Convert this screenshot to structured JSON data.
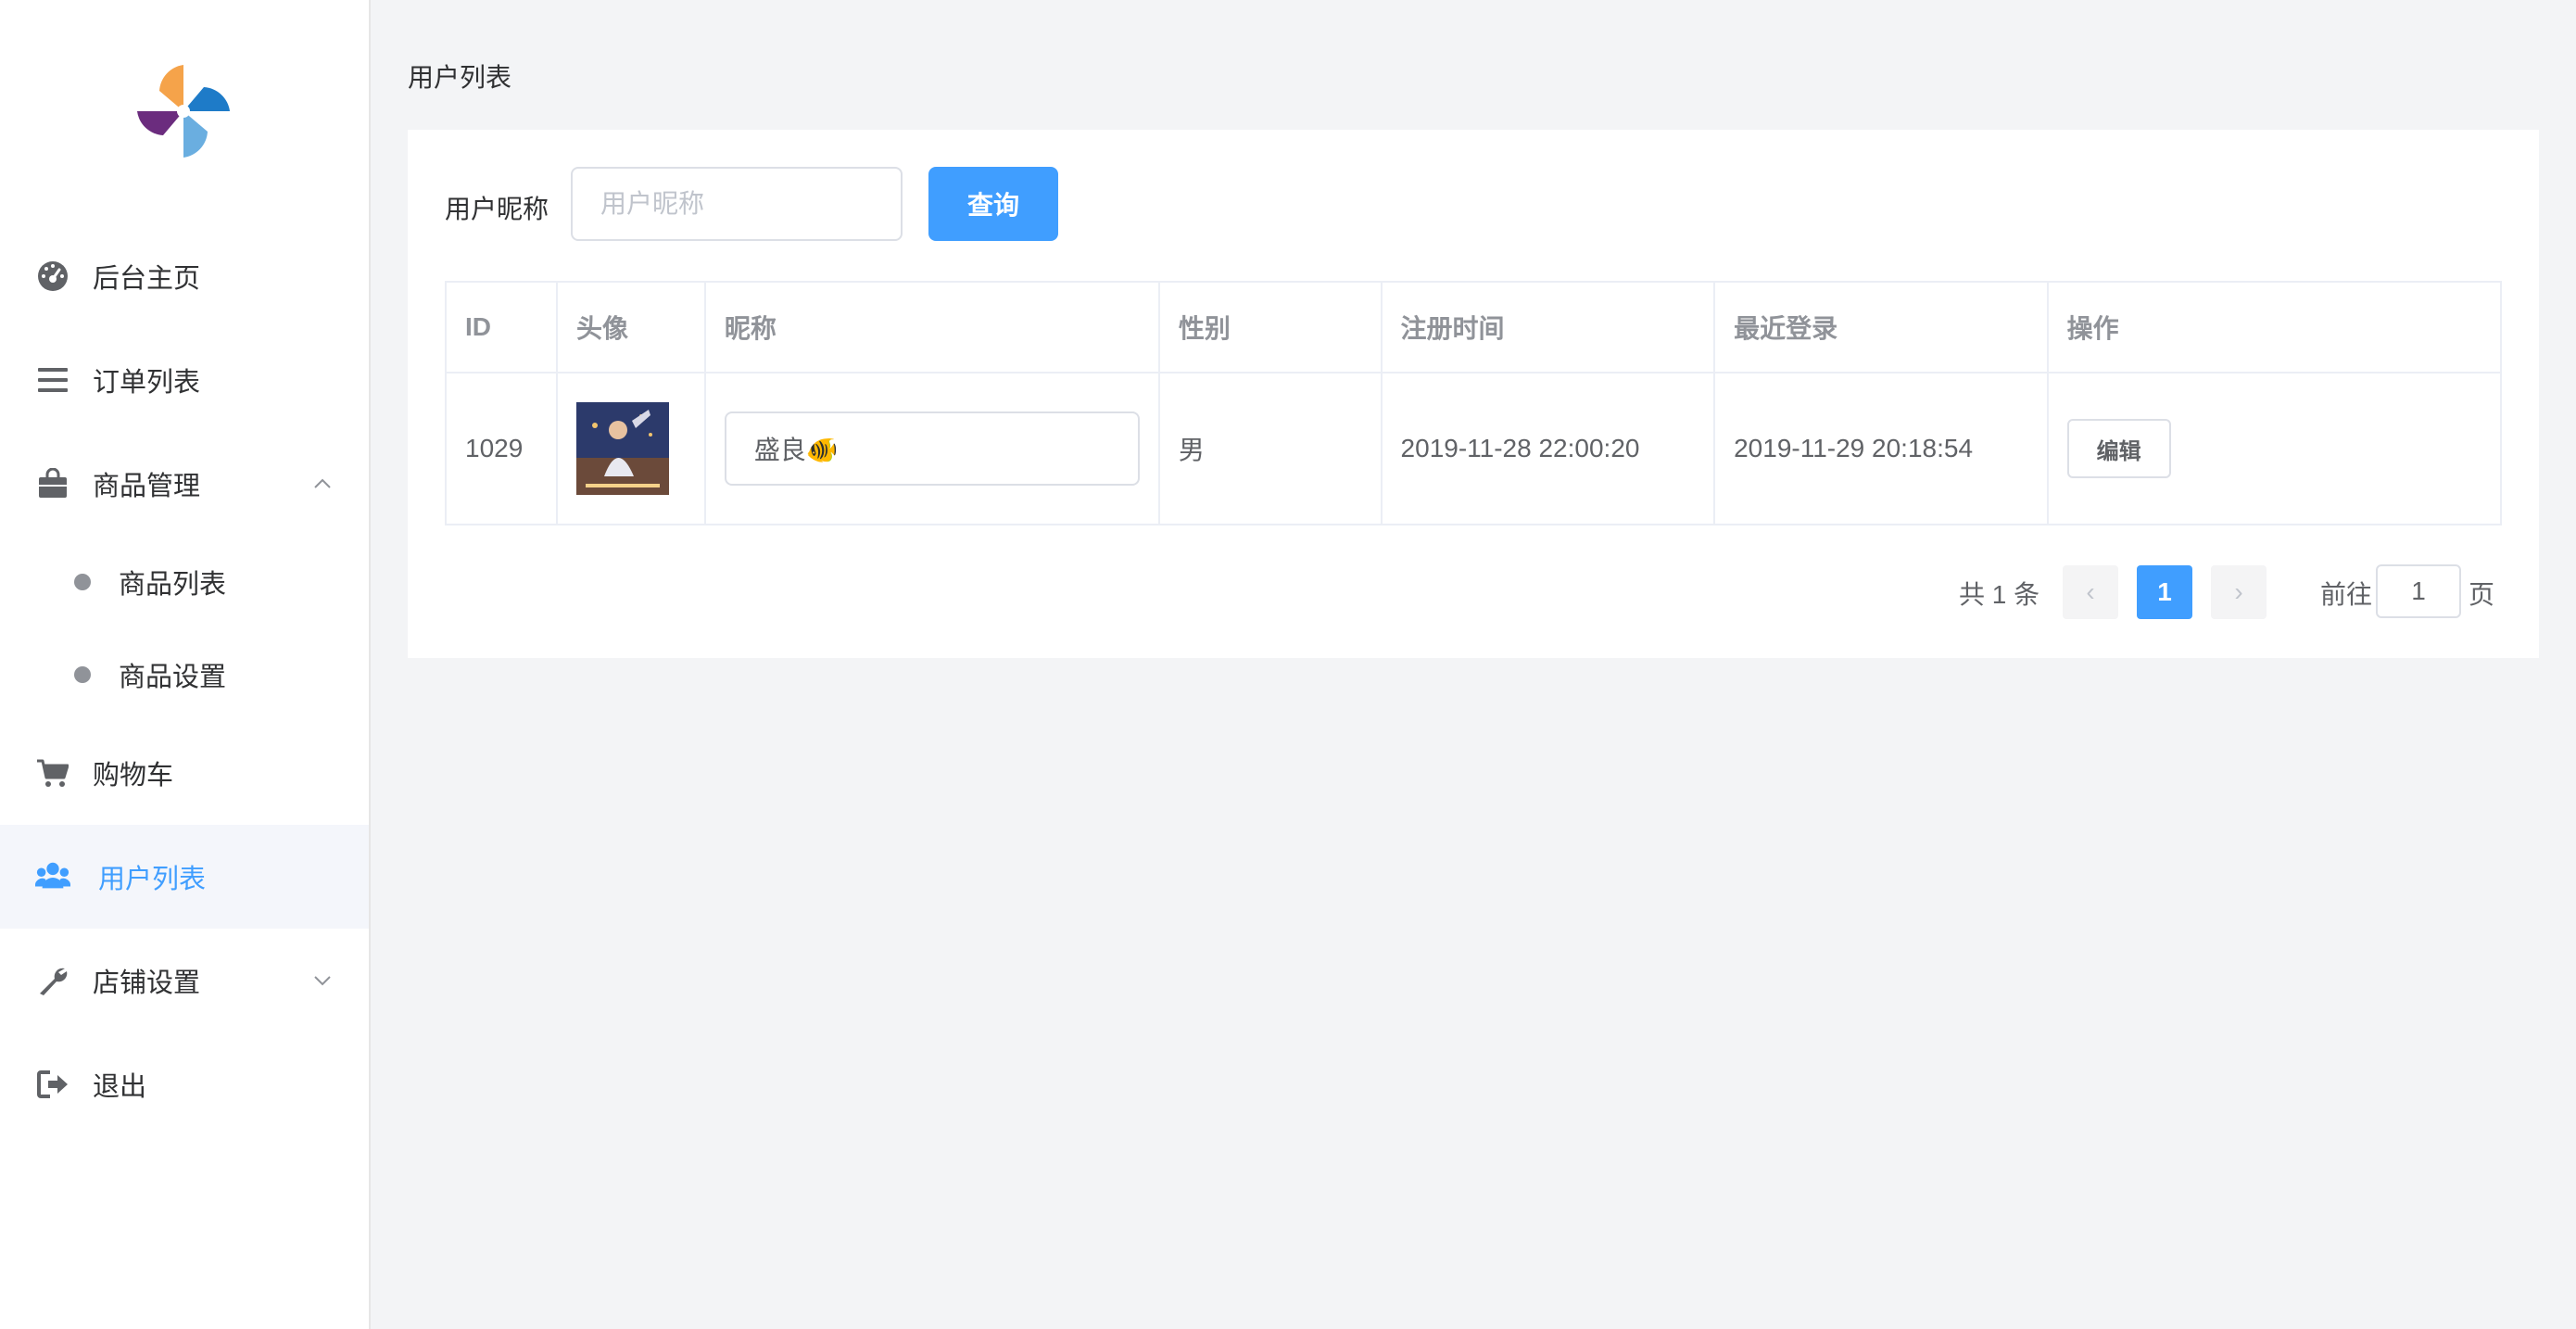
{
  "sidebar": {
    "logo": "pinwheel-logo",
    "items": [
      {
        "label": "后台主页",
        "icon": "dashboard-icon"
      },
      {
        "label": "订单列表",
        "icon": "list-icon"
      },
      {
        "label": "商品管理",
        "icon": "shopping-bag-icon",
        "expanded": true
      },
      {
        "label": "商品列表",
        "icon": "dot"
      },
      {
        "label": "商品设置",
        "icon": "dot"
      },
      {
        "label": "购物车",
        "icon": "cart-icon"
      },
      {
        "label": "用户列表",
        "icon": "users-icon",
        "active": true
      },
      {
        "label": "店铺设置",
        "icon": "wrench-icon",
        "expanded": false
      },
      {
        "label": "退出",
        "icon": "sign-out-icon"
      }
    ]
  },
  "page": {
    "title": "用户列表"
  },
  "filter": {
    "label": "用户昵称",
    "placeholder": "用户昵称",
    "query_label": "查询"
  },
  "table": {
    "columns": [
      "ID",
      "头像",
      "昵称",
      "性别",
      "注册时间",
      "最近登录",
      "操作"
    ],
    "rows": [
      {
        "id": "1029",
        "nickname": "盛良🐠",
        "gender": "男",
        "registered": "2019-11-28 22:00:20",
        "last_login": "2019-11-29 20:18:54",
        "action": "编辑"
      }
    ]
  },
  "pagination": {
    "total": "共 1 条",
    "prev": "‹",
    "current": "1",
    "next": "›",
    "goto_label": "前往",
    "goto_value": "1",
    "goto_suffix": "页"
  },
  "colors": {
    "accent": "#409eff",
    "sidebar_active_bg": "#f4f6fb",
    "background": "#f3f4f6"
  }
}
